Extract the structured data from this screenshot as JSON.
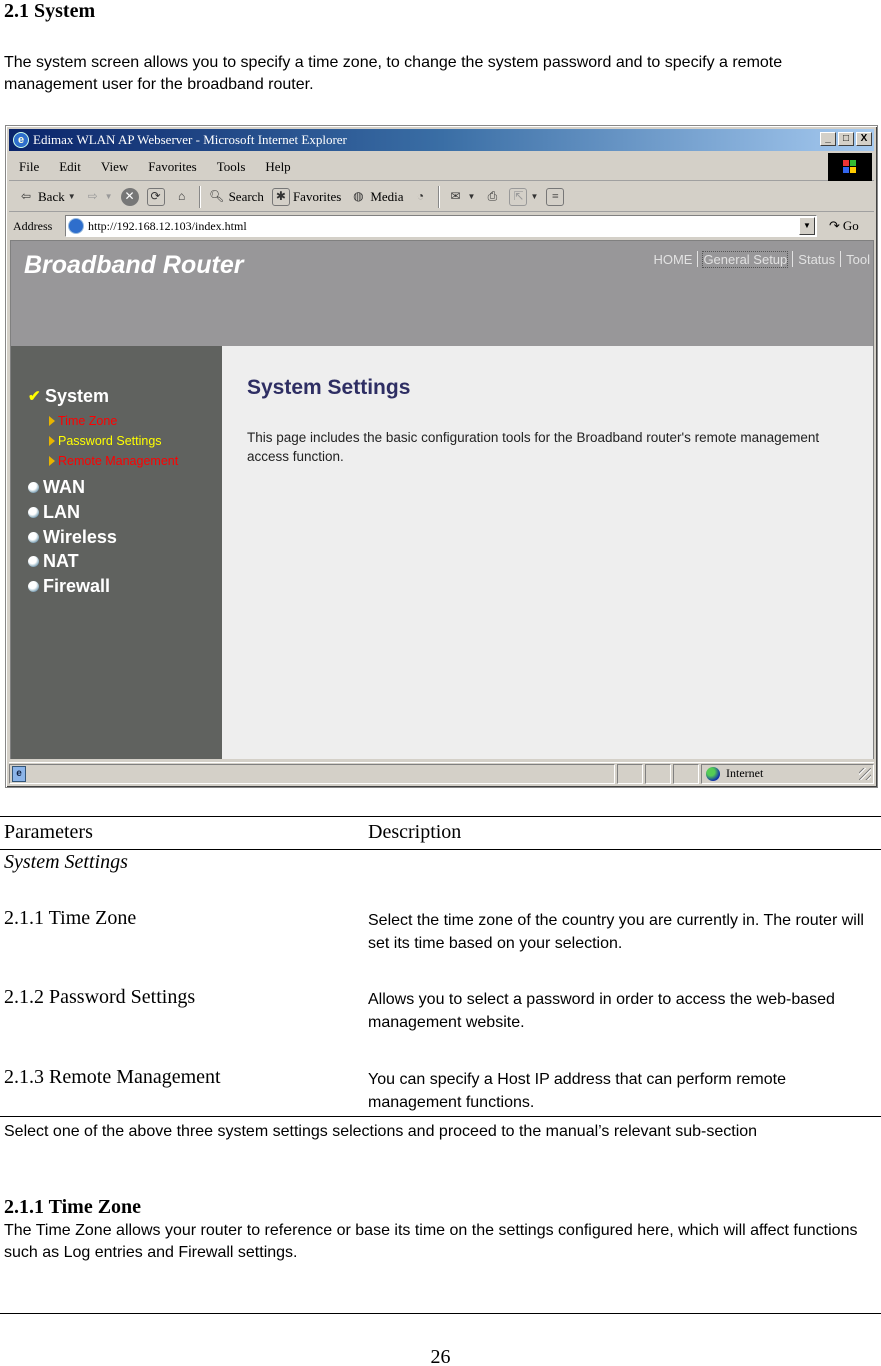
{
  "document": {
    "section_heading": "2.1 System",
    "intro": "The system screen allows you to specify a time zone, to change the system password and to specify a remote management user for the broadband router.",
    "table": {
      "headers": [
        "Parameters",
        "Description"
      ],
      "group_label": "System Settings",
      "rows": [
        {
          "name": "2.1.1 Time Zone",
          "description": "Select the time zone of the country you are currently in. The router will set its time based on your selection."
        },
        {
          "name": "2.1.2 Password Settings",
          "description": "Allows you to select a password in order to access the web-based management website."
        },
        {
          "name": "2.1.3 Remote Management",
          "description": "You can specify a Host IP address that can perform remote management functions."
        }
      ]
    },
    "select_note": "Select one of the above three system settings selections and proceed to the manual’s relevant sub-section",
    "sub_heading": "2.1.1 Time Zone",
    "time_zone_para": "The Time Zone allows your router to reference or base its time on the settings configured here, which will affect functions such as Log entries and Firewall settings.",
    "page_number": "26"
  },
  "browser": {
    "title": "Edimax WLAN AP Webserver - Microsoft Internet Explorer",
    "window_buttons": [
      "_",
      "□",
      "X"
    ],
    "menu": [
      "File",
      "Edit",
      "View",
      "Favorites",
      "Tools",
      "Help"
    ],
    "toolbar": {
      "back": "Back",
      "search": "Search",
      "favorites": "Favorites",
      "media": "Media"
    },
    "address_label": "Address",
    "url": "http://192.168.12.103/index.html",
    "go_label": "Go",
    "status_zone": "Internet"
  },
  "router": {
    "logo": "Broadband Router",
    "top_nav": [
      "HOME",
      "General Setup",
      "Status",
      "Tool"
    ],
    "top_nav_active": "General Setup",
    "sidebar": {
      "active_section": "System",
      "sub_items": [
        {
          "label": "Time Zone",
          "color": "#ff0000"
        },
        {
          "label": "Password Settings",
          "color": "#ffff00"
        },
        {
          "label": "Remote Management",
          "color": "#ff0000"
        }
      ],
      "sections": [
        "WAN",
        "LAN",
        "Wireless",
        "NAT",
        "Firewall"
      ]
    },
    "content": {
      "title": "System Settings",
      "description": "This page includes the basic configuration tools for the Broadband router's remote management access function."
    }
  }
}
